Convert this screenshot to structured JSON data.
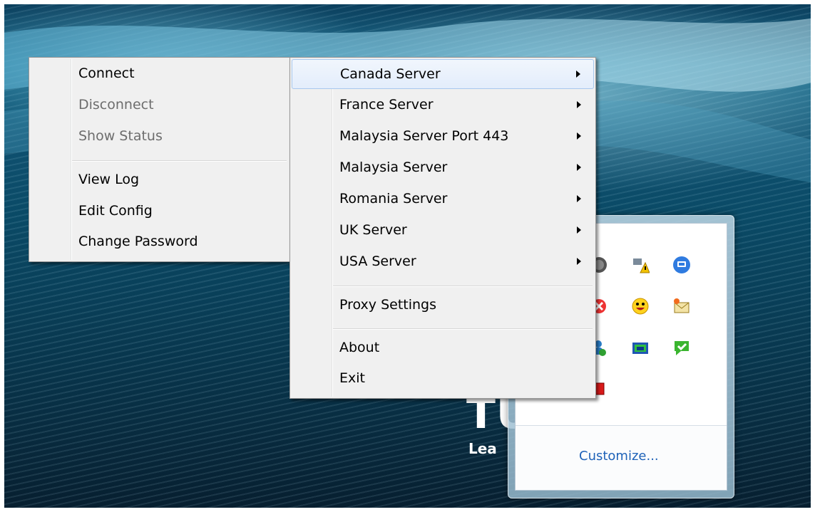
{
  "background": {
    "large_text": "TU",
    "small_text": "Lea"
  },
  "context_menu": {
    "items": [
      {
        "label": "Connect",
        "enabled": true
      },
      {
        "label": "Disconnect",
        "enabled": false
      },
      {
        "label": "Show Status",
        "enabled": false
      },
      {
        "label": "View Log",
        "enabled": true
      },
      {
        "label": "Edit Config",
        "enabled": true
      },
      {
        "label": "Change Password",
        "enabled": true
      }
    ]
  },
  "submenu": {
    "items": [
      {
        "label": "Canada Server",
        "has_submenu": true,
        "highlighted": true
      },
      {
        "label": "France Server",
        "has_submenu": true
      },
      {
        "label": "Malaysia Server Port 443",
        "has_submenu": true
      },
      {
        "label": "Malaysia Server",
        "has_submenu": true
      },
      {
        "label": "Romania Server",
        "has_submenu": true
      },
      {
        "label": "UK Server",
        "has_submenu": true
      },
      {
        "label": "USA Server",
        "has_submenu": true
      },
      {
        "label": "Proxy Settings",
        "has_submenu": false
      },
      {
        "label": "About",
        "has_submenu": false
      },
      {
        "label": "Exit",
        "has_submenu": false
      }
    ]
  },
  "tray": {
    "customize_label": "Customize...",
    "icons": [
      "globe-icon",
      "network-warning-icon",
      "monitor-chat-icon",
      "shield-x-icon",
      "smiley-messenger-icon",
      "new-mail-icon",
      "users-icon",
      "network-connection-icon",
      "green-check-chat-icon",
      "folder-icon",
      "red-box-icon"
    ]
  },
  "colors": {
    "menu_bg": "#f0f0f0",
    "highlight_border": "#a8c8ee",
    "link": "#1e62b8"
  }
}
